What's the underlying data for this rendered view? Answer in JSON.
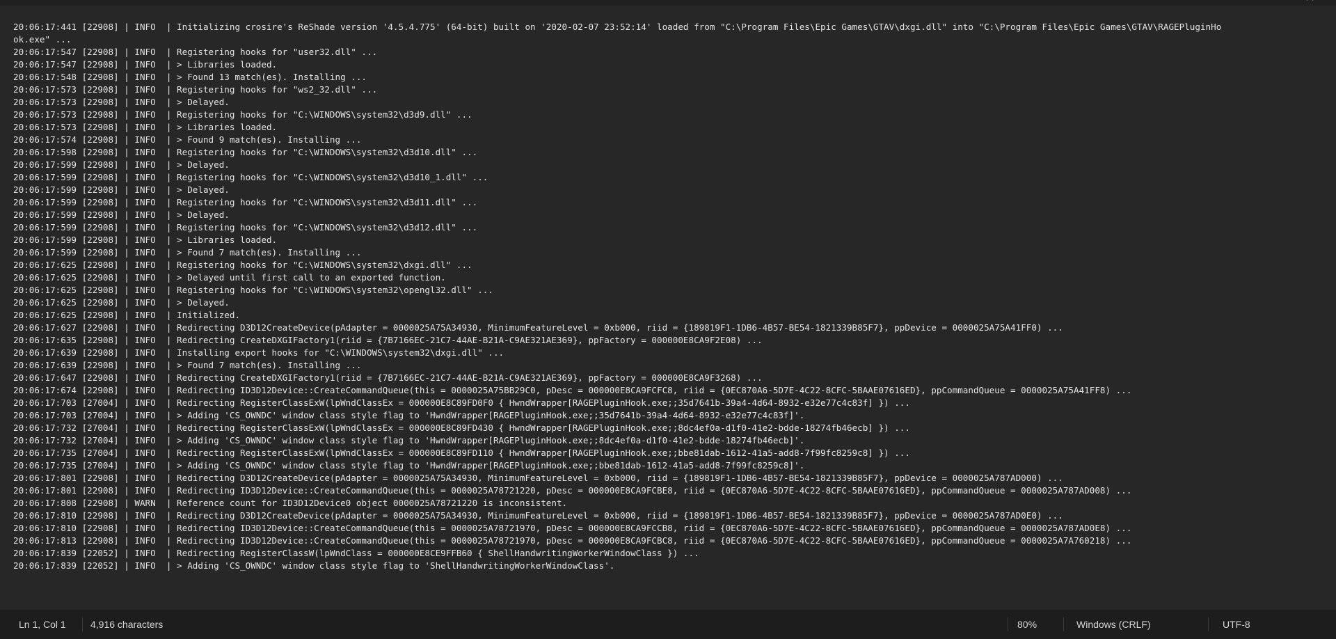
{
  "log_lines": [
    "20:06:17:441 [22908] | INFO  | Initializing crosire's ReShade version '4.5.4.775' (64-bit) built on '2020-02-07 23:52:14' loaded from \"C:\\Program Files\\Epic Games\\GTAV\\dxgi.dll\" into \"C:\\Program Files\\Epic Games\\GTAV\\RAGEPluginHook.exe\" ...",
    "20:06:17:547 [22908] | INFO  | Registering hooks for \"user32.dll\" ...",
    "20:06:17:547 [22908] | INFO  | > Libraries loaded.",
    "20:06:17:548 [22908] | INFO  | > Found 13 match(es). Installing ...",
    "20:06:17:573 [22908] | INFO  | Registering hooks for \"ws2_32.dll\" ...",
    "20:06:17:573 [22908] | INFO  | > Delayed.",
    "20:06:17:573 [22908] | INFO  | Registering hooks for \"C:\\WINDOWS\\system32\\d3d9.dll\" ...",
    "20:06:17:573 [22908] | INFO  | > Libraries loaded.",
    "20:06:17:574 [22908] | INFO  | > Found 9 match(es). Installing ...",
    "20:06:17:598 [22908] | INFO  | Registering hooks for \"C:\\WINDOWS\\system32\\d3d10.dll\" ...",
    "20:06:17:599 [22908] | INFO  | > Delayed.",
    "20:06:17:599 [22908] | INFO  | Registering hooks for \"C:\\WINDOWS\\system32\\d3d10_1.dll\" ...",
    "20:06:17:599 [22908] | INFO  | > Delayed.",
    "20:06:17:599 [22908] | INFO  | Registering hooks for \"C:\\WINDOWS\\system32\\d3d11.dll\" ...",
    "20:06:17:599 [22908] | INFO  | > Delayed.",
    "20:06:17:599 [22908] | INFO  | Registering hooks for \"C:\\WINDOWS\\system32\\d3d12.dll\" ...",
    "20:06:17:599 [22908] | INFO  | > Libraries loaded.",
    "20:06:17:599 [22908] | INFO  | > Found 7 match(es). Installing ...",
    "20:06:17:625 [22908] | INFO  | Registering hooks for \"C:\\WINDOWS\\system32\\dxgi.dll\" ...",
    "20:06:17:625 [22908] | INFO  | > Delayed until first call to an exported function.",
    "20:06:17:625 [22908] | INFO  | Registering hooks for \"C:\\WINDOWS\\system32\\opengl32.dll\" ...",
    "20:06:17:625 [22908] | INFO  | > Delayed.",
    "20:06:17:625 [22908] | INFO  | Initialized.",
    "20:06:17:627 [22908] | INFO  | Redirecting D3D12CreateDevice(pAdapter = 0000025A75A34930, MinimumFeatureLevel = 0xb000, riid = {189819F1-1DB6-4B57-BE54-1821339B85F7}, ppDevice = 0000025A75A41FF0) ...",
    "20:06:17:635 [22908] | INFO  | Redirecting CreateDXGIFactory1(riid = {7B7166EC-21C7-44AE-B21A-C9AE321AE369}, ppFactory = 000000E8CA9F2E08) ...",
    "20:06:17:639 [22908] | INFO  | Installing export hooks for \"C:\\WINDOWS\\system32\\dxgi.dll\" ...",
    "20:06:17:639 [22908] | INFO  | > Found 7 match(es). Installing ...",
    "20:06:17:647 [22908] | INFO  | Redirecting CreateDXGIFactory1(riid = {7B7166EC-21C7-44AE-B21A-C9AE321AE369}, ppFactory = 000000E8CA9F3268) ...",
    "20:06:17:674 [22908] | INFO  | Redirecting ID3D12Device::CreateCommandQueue(this = 0000025A75BB29C0, pDesc = 000000E8CA9FCFC8, riid = {0EC870A6-5D7E-4C22-8CFC-5BAAE07616ED}, ppCommandQueue = 0000025A75A41FF8) ...",
    "20:06:17:703 [27004] | INFO  | Redirecting RegisterClassExW(lpWndClassEx = 000000E8C89FD0F0 { HwndWrapper[RAGEPluginHook.exe;;35d7641b-39a4-4d64-8932-e32e77c4c83f] }) ...",
    "20:06:17:703 [27004] | INFO  | > Adding 'CS_OWNDC' window class style flag to 'HwndWrapper[RAGEPluginHook.exe;;35d7641b-39a4-4d64-8932-e32e77c4c83f]'.",
    "20:06:17:732 [27004] | INFO  | Redirecting RegisterClassExW(lpWndClassEx = 000000E8C89FD430 { HwndWrapper[RAGEPluginHook.exe;;8dc4ef0a-d1f0-41e2-bdde-18274fb46ecb] }) ...",
    "20:06:17:732 [27004] | INFO  | > Adding 'CS_OWNDC' window class style flag to 'HwndWrapper[RAGEPluginHook.exe;;8dc4ef0a-d1f0-41e2-bdde-18274fb46ecb]'.",
    "20:06:17:735 [27004] | INFO  | Redirecting RegisterClassExW(lpWndClassEx = 000000E8C89FD110 { HwndWrapper[RAGEPluginHook.exe;;bbe81dab-1612-41a5-add8-7f99fc8259c8] }) ...",
    "20:06:17:735 [27004] | INFO  | > Adding 'CS_OWNDC' window class style flag to 'HwndWrapper[RAGEPluginHook.exe;;bbe81dab-1612-41a5-add8-7f99fc8259c8]'.",
    "20:06:17:801 [22908] | INFO  | Redirecting D3D12CreateDevice(pAdapter = 0000025A75A34930, MinimumFeatureLevel = 0xb000, riid = {189819F1-1DB6-4B57-BE54-1821339B85F7}, ppDevice = 0000025A787AD000) ...",
    "20:06:17:801 [22908] | INFO  | Redirecting ID3D12Device::CreateCommandQueue(this = 0000025A78721220, pDesc = 000000E8CA9FCBE8, riid = {0EC870A6-5D7E-4C22-8CFC-5BAAE07616ED}, ppCommandQueue = 0000025A787AD008) ...",
    "20:06:17:808 [22908] | WARN  | Reference count for ID3D12Device0 object 0000025A78721220 is inconsistent.",
    "20:06:17:810 [22908] | INFO  | Redirecting D3D12CreateDevice(pAdapter = 0000025A75A34930, MinimumFeatureLevel = 0xb000, riid = {189819F1-1DB6-4B57-BE54-1821339B85F7}, ppDevice = 0000025A787AD0E0) ...",
    "20:06:17:810 [22908] | INFO  | Redirecting ID3D12Device::CreateCommandQueue(this = 0000025A78721970, pDesc = 000000E8CA9FCCB8, riid = {0EC870A6-5D7E-4C22-8CFC-5BAAE07616ED}, ppCommandQueue = 0000025A787AD0E8) ...",
    "20:06:17:813 [22908] | INFO  | Redirecting ID3D12Device::CreateCommandQueue(this = 0000025A78721970, pDesc = 000000E8CA9FCBC8, riid = {0EC870A6-5D7E-4C22-8CFC-5BAAE07616ED}, ppCommandQueue = 0000025A7A760218) ...",
    "20:06:17:839 [22052] | INFO  | Redirecting RegisterClassW(lpWndClass = 000000E8CE9FFB60 { ShellHandwritingWorkerWindowClass }) ...",
    "20:06:17:839 [22052] | INFO  | > Adding 'CS_OWNDC' window class style flag to 'ShellHandwritingWorkerWindowClass'."
  ],
  "statusbar": {
    "cursor_position": "Ln 1, Col 1",
    "char_count": "4,916 characters",
    "zoom": "80%",
    "line_ending": "Windows (CRLF)",
    "encoding": "UTF-8"
  }
}
